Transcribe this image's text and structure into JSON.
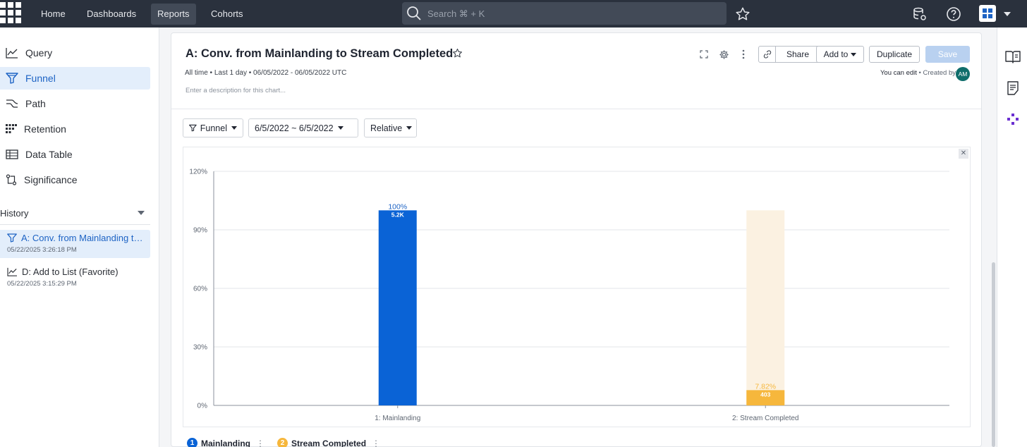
{
  "nav": {
    "items": [
      "Home",
      "Dashboards",
      "Reports",
      "Cohorts"
    ],
    "active": "Reports",
    "search_placeholder": "Search ⌘ + K"
  },
  "sidebar": {
    "items": [
      {
        "label": "Query",
        "icon": "line-chart-icon"
      },
      {
        "label": "Funnel",
        "icon": "funnel-icon",
        "active": true
      },
      {
        "label": "Path",
        "icon": "path-icon"
      },
      {
        "label": "Retention",
        "icon": "retention-grid-icon"
      },
      {
        "label": "Data Table",
        "icon": "table-icon"
      },
      {
        "label": "Significance",
        "icon": "significance-icon"
      }
    ],
    "history_label": "History",
    "history": [
      {
        "title": "A: Conv. from Mainlanding to ...",
        "time": "05/22/2025 3:26:18 PM",
        "icon": "funnel-icon",
        "active": true
      },
      {
        "title": "D: Add to List (Favorite)",
        "time": "05/22/2025 3:15:29 PM",
        "icon": "line-chart-icon"
      }
    ]
  },
  "report": {
    "title": "A: Conv. from Mainlanding to Stream Completed",
    "subline": "All time • Last 1 day • 06/05/2022 - 06/05/2022 UTC",
    "description_placeholder": "Enter a description for this chart...",
    "edit_text": "You can edit",
    "created_text": " • Created by",
    "avatar_initials": "AM",
    "buttons": {
      "share": "Share",
      "add_to": "Add to",
      "duplicate": "Duplicate",
      "save": "Save"
    },
    "controls": {
      "type": "Funnel",
      "date_range": "6/5/2022 ~ 6/5/2022",
      "mode": "Relative"
    }
  },
  "chart_data": {
    "type": "bar",
    "categories": [
      "1: Mainlanding",
      "2: Stream Completed"
    ],
    "values": [
      100,
      7.82
    ],
    "value_labels": [
      "100%",
      "7.82%"
    ],
    "count_labels": [
      "5.2K",
      "403"
    ],
    "ylim": [
      0,
      120
    ],
    "yticks": [
      0,
      30,
      60,
      90,
      120
    ],
    "ytick_labels": [
      "0%",
      "30%",
      "60%",
      "90%",
      "120%"
    ],
    "colors": [
      "#0a63d6",
      "#f6b73c"
    ],
    "label_colors": [
      "#1d63c4",
      "#f6b73c"
    ],
    "ghost_color": "#fbf1e1",
    "grid": true
  },
  "legend": [
    {
      "num": "1",
      "label": "Mainlanding",
      "color": "#0a63d6"
    },
    {
      "num": "2",
      "label": "Stream Completed",
      "color": "#f6b73c"
    }
  ]
}
